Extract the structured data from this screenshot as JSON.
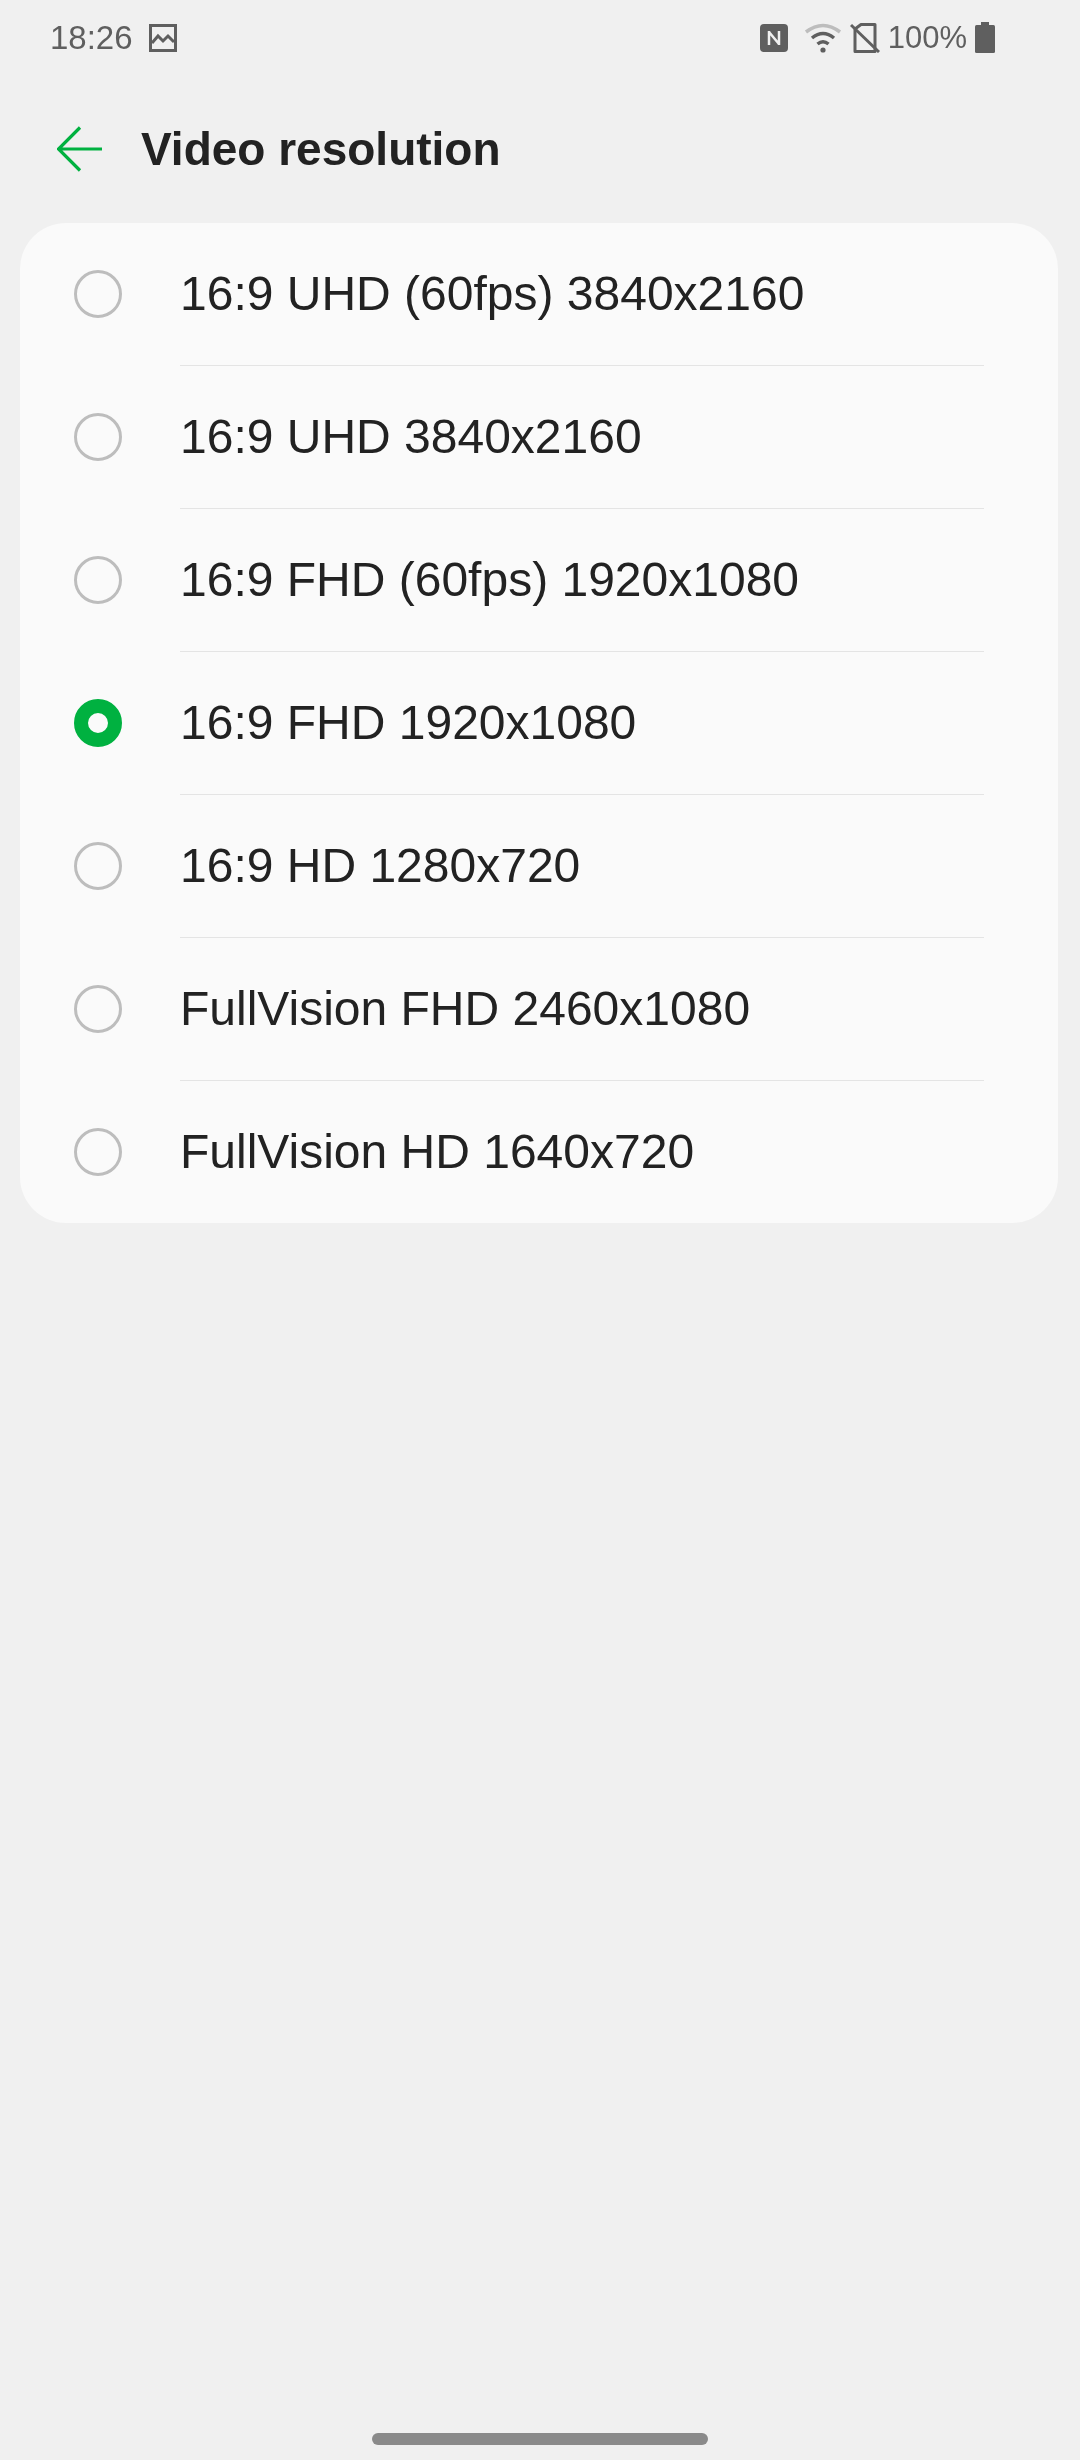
{
  "status_bar": {
    "time": "18:26",
    "battery": "100%"
  },
  "header": {
    "title": "Video resolution"
  },
  "options": [
    {
      "label": "16:9 UHD (60fps) 3840x2160",
      "selected": false
    },
    {
      "label": "16:9 UHD 3840x2160",
      "selected": false
    },
    {
      "label": "16:9 FHD (60fps) 1920x1080",
      "selected": false
    },
    {
      "label": "16:9 FHD 1920x1080",
      "selected": true
    },
    {
      "label": "16:9 HD 1280x720",
      "selected": false
    },
    {
      "label": "FullVision FHD 2460x1080",
      "selected": false
    },
    {
      "label": "FullVision HD 1640x720",
      "selected": false
    }
  ]
}
